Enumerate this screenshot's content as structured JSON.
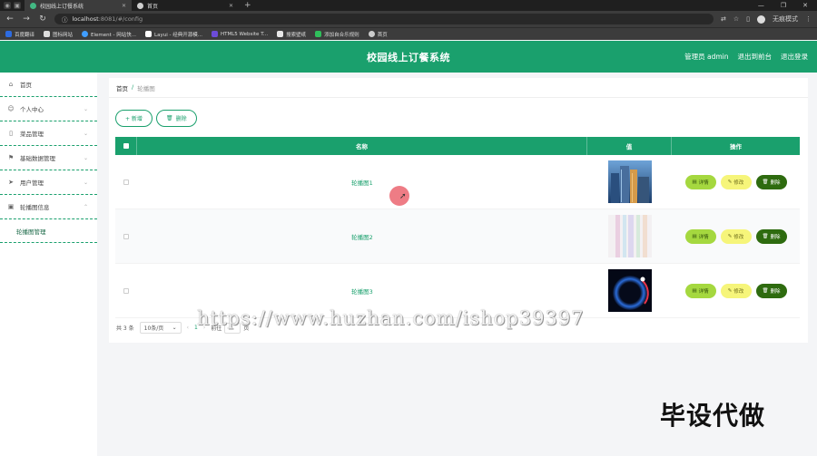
{
  "browser": {
    "tabs": [
      {
        "label": "校园线上订餐系统",
        "active": true
      },
      {
        "label": "首页",
        "active": false
      }
    ],
    "url_host": "localhost",
    "url_path": ":8081/#/config",
    "profile_label": "无痕模式",
    "bookmarks": [
      "百度翻译",
      "图标网站",
      "Element - 网站快...",
      "Layui - 经典开源模...",
      "HTML5 Website T...",
      "搜索壁纸",
      "添加自合乐规则",
      "首页"
    ]
  },
  "header": {
    "title": "校园线上订餐系统",
    "user": "管理员 admin",
    "back_to_front": "退出到前台",
    "logout": "退出登录"
  },
  "sidebar": {
    "items": [
      {
        "label": "首页",
        "icon": "home-icon"
      },
      {
        "label": "个人中心",
        "icon": "user-icon"
      },
      {
        "label": "菜品管理",
        "icon": "phone-icon"
      },
      {
        "label": "基础数据管理",
        "icon": "flag-icon"
      },
      {
        "label": "用户管理",
        "icon": "send-icon"
      },
      {
        "label": "轮播图信息",
        "icon": "image-icon"
      }
    ],
    "sub_item": "轮播图管理"
  },
  "breadcrumb": {
    "home": "首页",
    "sep": "/",
    "current": "轮播图"
  },
  "toolbar": {
    "add": "+ 新增",
    "delete": "删除"
  },
  "table": {
    "headers": {
      "name": "名称",
      "value": "值",
      "ops": "操作"
    },
    "rows": [
      {
        "name": "轮播图1",
        "thumb": "city"
      },
      {
        "name": "轮播图2",
        "thumb": "pastel"
      },
      {
        "name": "轮播图3",
        "thumb": "planet"
      }
    ],
    "op_labels": {
      "detail": "详情",
      "edit": "修改",
      "delete": "删除"
    }
  },
  "pager": {
    "total": "共 3 条",
    "page_size": "10条/页",
    "page": "1",
    "goto": "前往",
    "page_unit": "页"
  },
  "overlay": {
    "watermark": "https://www.huzhan.com/ishop39397",
    "stamp": "毕设代做"
  },
  "colors": {
    "brand": "#1aa06d",
    "detail": "#a5d83f",
    "edit": "#f6f57a",
    "delete": "#2e6b0f"
  }
}
